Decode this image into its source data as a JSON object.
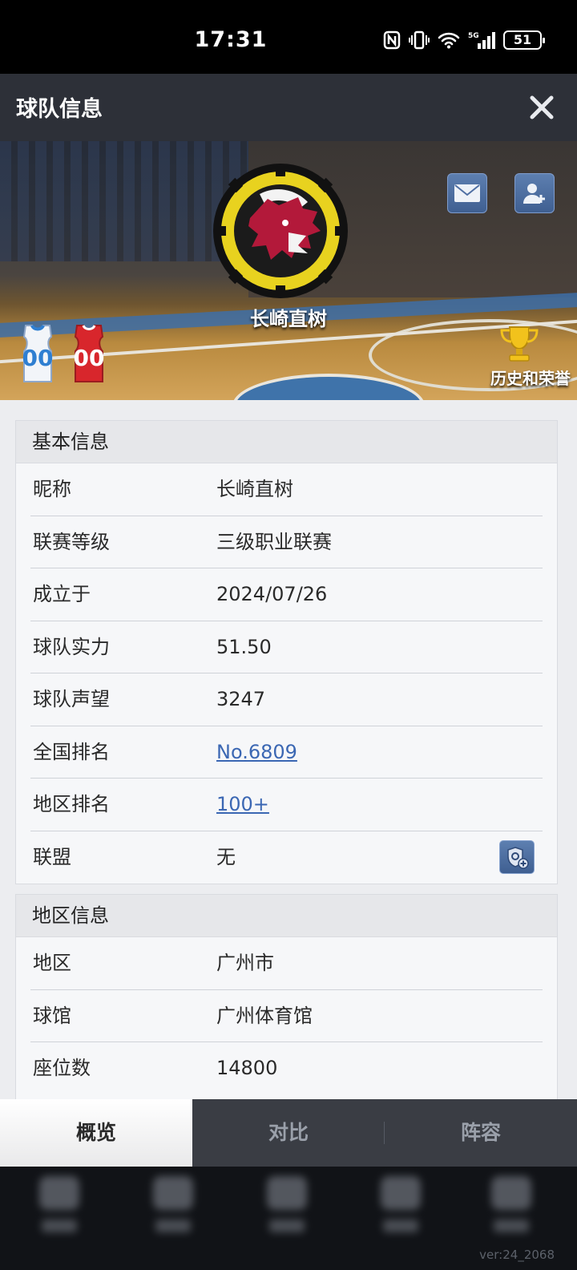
{
  "status_bar": {
    "time": "17:31",
    "battery": "51",
    "signal_label": "5G"
  },
  "header": {
    "title": "球队信息"
  },
  "hero": {
    "team_name": "长崎直树",
    "jersey_home_number": "00",
    "jersey_away_number": "00",
    "history_label": "历史和荣誉"
  },
  "basic_info": {
    "title": "基本信息",
    "rows": [
      {
        "label": "昵称",
        "value": "长崎直树"
      },
      {
        "label": "联赛等级",
        "value": "三级职业联赛"
      },
      {
        "label": "成立于",
        "value": "2024/07/26"
      },
      {
        "label": "球队实力",
        "value": "51.50"
      },
      {
        "label": "球队声望",
        "value": "3247"
      },
      {
        "label": "全国排名",
        "value": "No.6809"
      },
      {
        "label": "地区排名",
        "value": "100+"
      },
      {
        "label": "联盟",
        "value": "无"
      }
    ]
  },
  "region_info": {
    "title": "地区信息",
    "rows": [
      {
        "label": "地区",
        "value": "广州市"
      },
      {
        "label": "球馆",
        "value": "广州体育馆"
      },
      {
        "label": "座位数",
        "value": "14800"
      }
    ]
  },
  "tabs": [
    {
      "label": "概览",
      "active": true
    },
    {
      "label": "对比",
      "active": false
    },
    {
      "label": "阵容",
      "active": false
    }
  ],
  "version": "ver:24_2068",
  "colors": {
    "link": "#3b67b3",
    "header_bg": "#2d3038",
    "button_blue": "#4f6fa3",
    "logo_yellow": "#e8d21f",
    "logo_red": "#b3193a"
  }
}
